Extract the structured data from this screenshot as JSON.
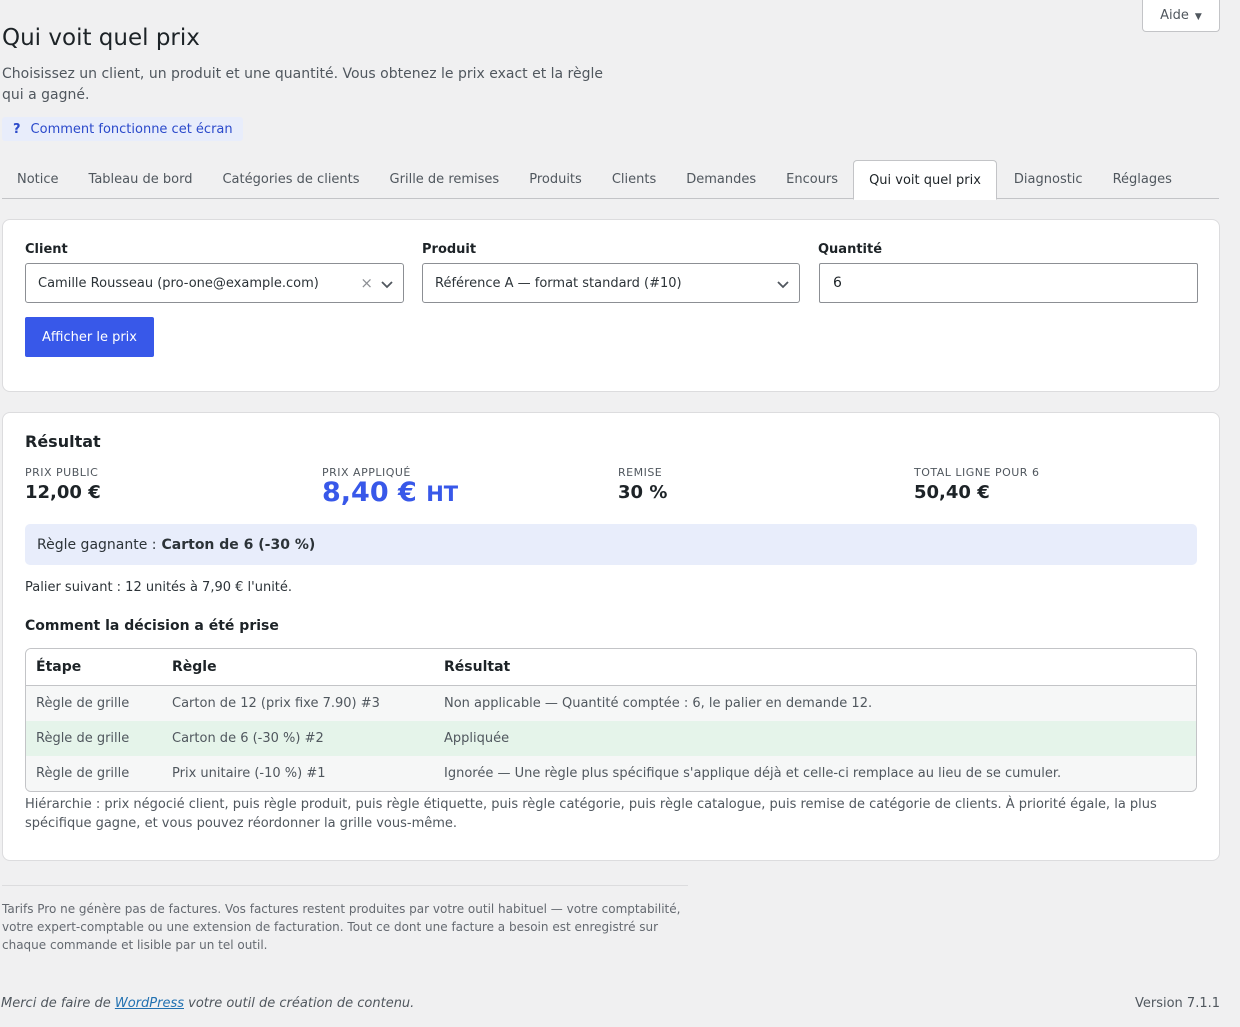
{
  "help": {
    "label": "Aide"
  },
  "page": {
    "title": "Qui voit quel prix",
    "intro": "Choisissez un client, un produit et une quantité. Vous obtenez le prix exact et la règle qui a gagné.",
    "howto_icon": "?",
    "howto": "Comment fonctionne cet écran"
  },
  "tabs": [
    {
      "label": "Notice"
    },
    {
      "label": "Tableau de bord"
    },
    {
      "label": "Catégories de clients"
    },
    {
      "label": "Grille de remises"
    },
    {
      "label": "Produits"
    },
    {
      "label": "Clients"
    },
    {
      "label": "Demandes"
    },
    {
      "label": "Encours"
    },
    {
      "label": "Qui voit quel prix",
      "active": true
    },
    {
      "label": "Diagnostic"
    },
    {
      "label": "Réglages"
    }
  ],
  "form": {
    "client_label": "Client",
    "client_value": "Camille Rousseau (pro-one@example.com)",
    "product_label": "Produit",
    "product_value": "Référence A — format standard (#10)",
    "qty_label": "Quantité",
    "qty_value": "6",
    "submit_label": "Afficher le prix"
  },
  "result": {
    "title": "Résultat",
    "public_label": "PRIX PUBLIC",
    "public_value": "12,00 €",
    "applied_label": "PRIX APPLIQUÉ",
    "applied_value": "8,40 €",
    "applied_unit": "HT",
    "discount_label": "REMISE",
    "discount_value": "30 %",
    "total_label": "TOTAL LIGNE POUR 6",
    "total_value": "50,40 €",
    "winner_prefix": "Règle gagnante :",
    "winner_rule": "Carton de 6 (-30 %)",
    "next_tier": "Palier suivant : 12 unités à 7,90 € l'unité.",
    "how_title": "Comment la décision a été prise",
    "table_headers": [
      "Étape",
      "Règle",
      "Résultat"
    ],
    "rows": [
      {
        "step": "Règle de grille",
        "rule": "Carton de 12 (prix fixe 7.90) #3",
        "result": "Non applicable — Quantité comptée : 6, le palier en demande 12.",
        "applied": false
      },
      {
        "step": "Règle de grille",
        "rule": "Carton de 6 (-30 %) #2",
        "result": "Appliquée",
        "applied": true
      },
      {
        "step": "Règle de grille",
        "rule": "Prix unitaire (-10 %) #1",
        "result": "Ignorée — Une règle plus spécifique s'applique déjà et celle-ci remplace au lieu de se cumuler.",
        "applied": false
      }
    ],
    "hierarchy": "Hiérarchie : prix négocié client, puis règle produit, puis règle étiquette, puis règle catégorie, puis règle catalogue, puis remise de catégorie de clients. À priorité égale, la plus spécifique gagne, et vous pouvez réordonner la grille vous-même."
  },
  "footer": {
    "note": "Tarifs Pro ne génère pas de factures. Vos factures restent produites par votre outil habituel — votre comptabilité, votre expert-comptable ou une extension de facturation. Tout ce dont une facture a besoin est enregistré sur chaque commande et lisible par un tel outil.",
    "thanks_before": "Merci de faire de",
    "thanks_link": "WordPress",
    "thanks_after": "votre outil de création de contenu.",
    "version": "Version 7.1.1"
  },
  "colors": {
    "accent": "#3858e9",
    "applied_row": "#e5f4ea",
    "info_bg": "#e8edfb"
  }
}
